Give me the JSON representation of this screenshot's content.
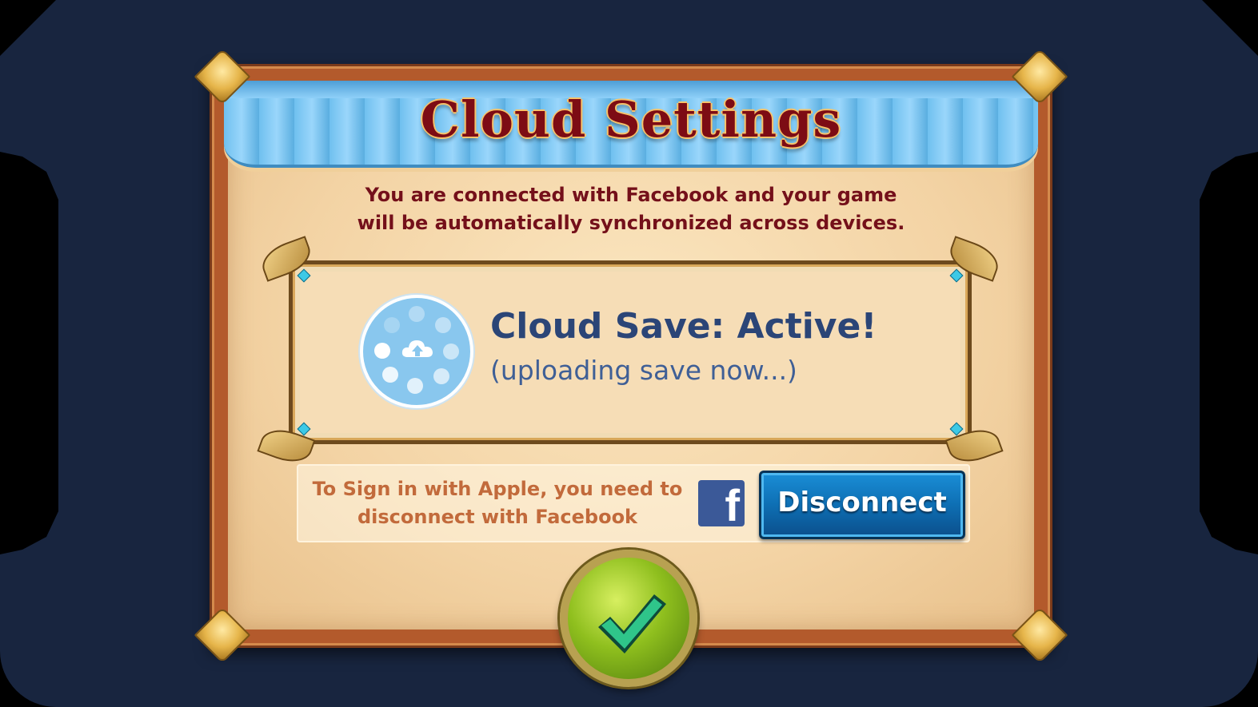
{
  "dialog": {
    "title": "Cloud Settings",
    "description_line1": "You are connected with Facebook and your game",
    "description_line2": "will be automatically synchronized across devices."
  },
  "status": {
    "main": "Cloud Save: Active!",
    "sub": "(uploading save now...)",
    "icon": "cloud-upload-icon"
  },
  "apple_notice": {
    "line1": "To Sign in with Apple, you need to",
    "line2": "disconnect with Facebook"
  },
  "facebook": {
    "icon": "facebook-icon",
    "glyph": "f",
    "brand_color": "#3b5998"
  },
  "buttons": {
    "disconnect_label": "Disconnect",
    "confirm_icon": "checkmark-icon"
  },
  "colors": {
    "title": "#7d0c14",
    "status_text": "#2b4577",
    "disconnect_button": "#0e6fb4",
    "confirm_button": "#8fbf1e",
    "background": "#18253f"
  }
}
